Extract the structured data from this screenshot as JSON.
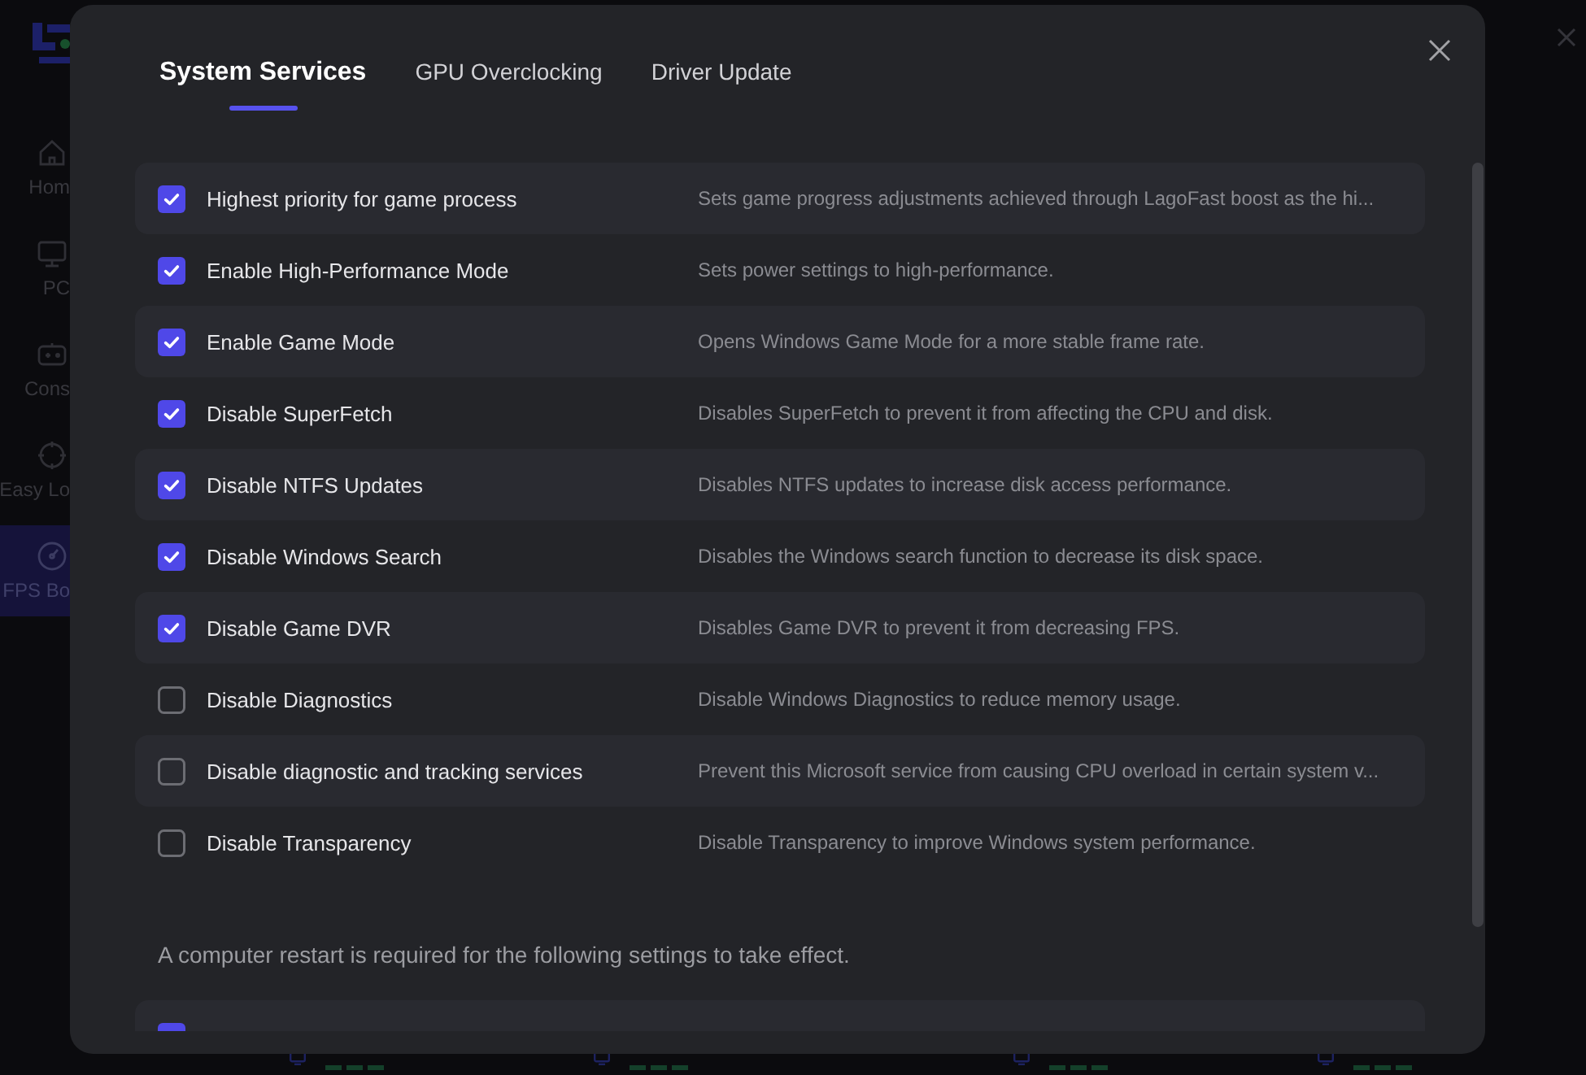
{
  "background_app": {
    "sidebar": {
      "items": [
        {
          "label": "Hom",
          "selected": false
        },
        {
          "label": "PC",
          "selected": false
        },
        {
          "label": "Cons",
          "selected": false
        },
        {
          "label": "Easy Lo",
          "selected": false
        },
        {
          "label": "FPS Bo",
          "selected": true
        }
      ]
    }
  },
  "dialog": {
    "tabs": [
      {
        "label": "System Services",
        "selected": true
      },
      {
        "label": "GPU Overclocking",
        "selected": false
      },
      {
        "label": "Driver Update",
        "selected": false
      }
    ],
    "settings": [
      {
        "label": "Highest priority for game process",
        "description": "Sets game progress adjustments achieved through LagoFast boost as the hi...",
        "checked": true
      },
      {
        "label": "Enable High-Performance Mode",
        "description": "Sets power settings to high-performance.",
        "checked": true
      },
      {
        "label": "Enable Game Mode",
        "description": "Opens Windows Game Mode for a more stable frame rate.",
        "checked": true
      },
      {
        "label": "Disable SuperFetch",
        "description": "Disables SuperFetch to prevent it from affecting the CPU and disk.",
        "checked": true
      },
      {
        "label": "Disable NTFS Updates",
        "description": "Disables NTFS updates to increase disk access performance.",
        "checked": true
      },
      {
        "label": "Disable Windows Search",
        "description": "Disables the Windows search function to decrease its disk space.",
        "checked": true
      },
      {
        "label": "Disable Game DVR",
        "description": "Disables Game DVR to prevent it from decreasing FPS.",
        "checked": true
      },
      {
        "label": "Disable Diagnostics",
        "description": "Disable Windows Diagnostics to reduce memory usage.",
        "checked": false
      },
      {
        "label": "Disable diagnostic and tracking services",
        "description": "Prevent this Microsoft service from causing CPU overload in certain system v...",
        "checked": false
      },
      {
        "label": "Disable Transparency",
        "description": "Disable Transparency to improve Windows system performance.",
        "checked": false
      }
    ],
    "restart_note": "A computer restart is required for the following settings to take effect.",
    "restart_settings": [
      {
        "checked": true
      }
    ]
  }
}
